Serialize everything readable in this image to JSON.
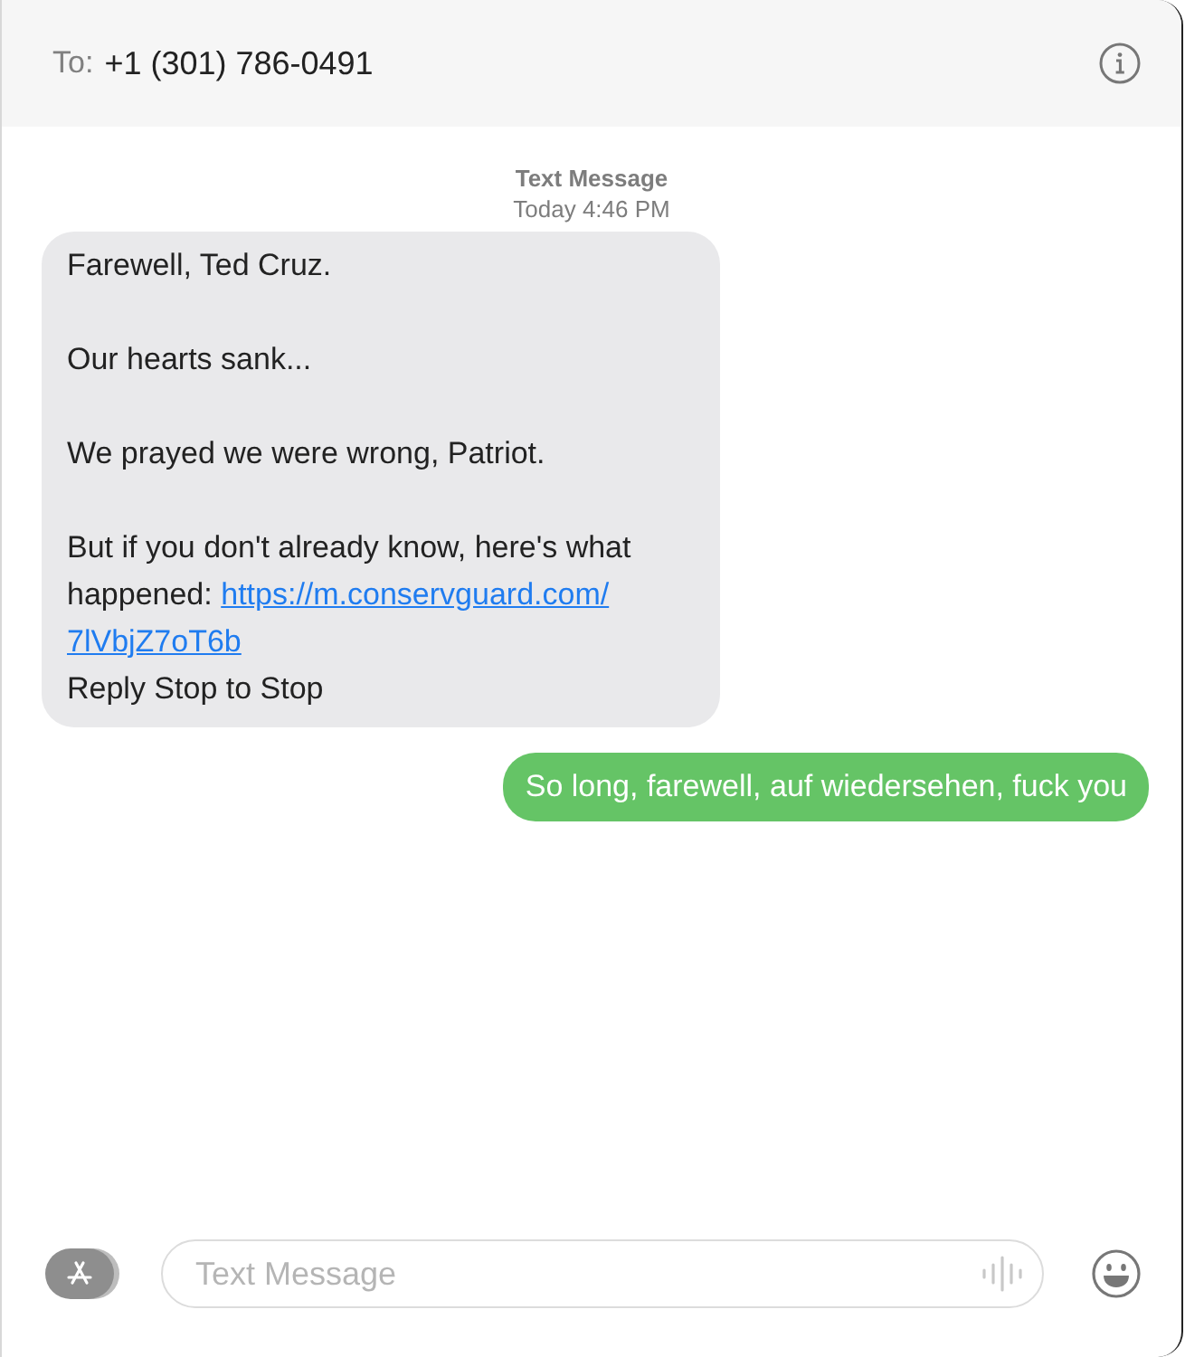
{
  "header": {
    "to_label": "To:",
    "recipient": "+1 (301) 786-0491"
  },
  "timestamp": {
    "service": "Text Message",
    "time": "Today 4:46 PM"
  },
  "messages": [
    {
      "kind": "incoming",
      "paragraphs": [
        {
          "text": "Farewell, Ted Cruz."
        },
        {
          "text": "Our hearts sank..."
        },
        {
          "text": "We prayed we were wrong, Patriot."
        },
        {
          "text": "But if you don't already know, here's what happened:",
          "link_lines": [
            "https://m.conservguard.com/",
            "7lVbjZ7oT6b"
          ],
          "after": "Reply Stop to Stop"
        }
      ]
    },
    {
      "kind": "outgoing",
      "paragraphs": [
        {
          "text": "So long, farewell, auf wiedersehen, fuck you"
        }
      ]
    }
  ],
  "composer": {
    "placeholder": "Text Message"
  }
}
